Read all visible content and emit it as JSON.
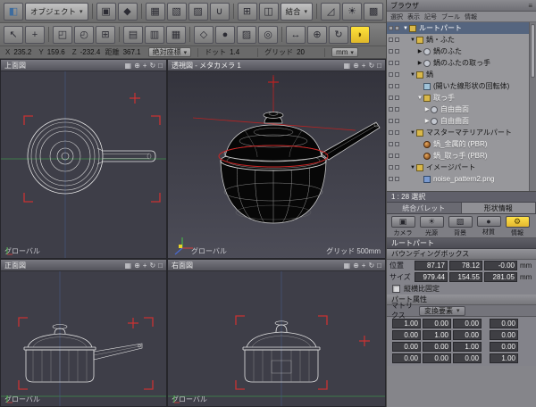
{
  "ui": {
    "dropdown_arrow": "▾"
  },
  "toolbar": {
    "row1": [
      {
        "type": "icon",
        "name": "object-cube-icon",
        "glyph": "◧",
        "tint": "#3d6c9e"
      },
      {
        "type": "drop",
        "name": "object-mode-dropdown",
        "label": "オブジェクト"
      },
      {
        "type": "sep"
      },
      {
        "type": "icon",
        "name": "create-part-icon",
        "glyph": "▣"
      },
      {
        "type": "icon",
        "name": "create-primitive-icon",
        "glyph": "◆"
      },
      {
        "type": "sep"
      },
      {
        "type": "icon",
        "name": "polygon-mesh-icon",
        "glyph": "▦"
      },
      {
        "type": "icon",
        "name": "subdivision-surface-icon",
        "glyph": "▧"
      },
      {
        "type": "icon",
        "name": "line-shape-icon",
        "glyph": "▨"
      },
      {
        "type": "icon",
        "name": "snap-magnet-icon",
        "glyph": "∪"
      },
      {
        "type": "sep"
      },
      {
        "type": "icon",
        "name": "grid-snap-icon",
        "glyph": "⊞"
      },
      {
        "type": "icon",
        "name": "mirror-icon",
        "glyph": "◫"
      },
      {
        "type": "drop",
        "name": "join-mode-dropdown",
        "label": "結合"
      },
      {
        "type": "sep"
      },
      {
        "type": "icon",
        "name": "measure-icon",
        "glyph": "◿"
      },
      {
        "type": "icon",
        "name": "light-icon",
        "glyph": "☀"
      },
      {
        "type": "icon",
        "name": "render-settings-icon",
        "glyph": "▩"
      }
    ],
    "row2": [
      {
        "type": "icon",
        "name": "select-tool-icon",
        "glyph": "↖"
      },
      {
        "type": "icon",
        "name": "move-tool-icon",
        "glyph": "+"
      },
      {
        "type": "sep"
      },
      {
        "type": "icon",
        "name": "scale-manipulator-icon",
        "glyph": "◰"
      },
      {
        "type": "icon",
        "name": "rotate-manipulator-icon",
        "glyph": "◴"
      },
      {
        "type": "icon",
        "name": "grid-plane-icon",
        "glyph": "⊞"
      },
      {
        "type": "sep"
      },
      {
        "type": "icon",
        "name": "layout-single-view-icon",
        "glyph": "▤"
      },
      {
        "type": "icon",
        "name": "layout-quad-view-icon",
        "glyph": "▥"
      },
      {
        "type": "icon",
        "name": "layout-custom-view-icon",
        "glyph": "▦"
      },
      {
        "type": "sep"
      },
      {
        "type": "icon",
        "name": "wireframe-display-icon",
        "glyph": "◇"
      },
      {
        "type": "icon",
        "name": "shaded-display-icon",
        "glyph": "●"
      },
      {
        "type": "icon",
        "name": "texture-display-icon",
        "glyph": "▨"
      },
      {
        "type": "icon",
        "name": "camera-display-icon",
        "glyph": "◎"
      },
      {
        "type": "sep"
      },
      {
        "type": "icon",
        "name": "pan-view-icon",
        "glyph": "↔"
      },
      {
        "type": "icon",
        "name": "zoom-view-icon",
        "glyph": "⊕"
      },
      {
        "type": "icon",
        "name": "rotate-view-icon",
        "glyph": "↻"
      },
      {
        "type": "icon",
        "name": "memo-bubble-icon",
        "glyph": "◗",
        "accent": true
      }
    ]
  },
  "coordbar": {
    "x_label": "X",
    "x": "235.2",
    "y_label": "Y",
    "y": "159.6",
    "z_label": "Z",
    "z": "-232.4",
    "dist_label": "距離",
    "dist": "367.1",
    "mode": "絶対座標",
    "dot_label": "ドット",
    "dot": "1.4",
    "grid_label": "グリッド",
    "grid": "20",
    "unit": "mm"
  },
  "vp_icons": [
    {
      "name": "viewport-layout-icon",
      "glyph": "▦"
    },
    {
      "name": "viewport-zoom-icon",
      "glyph": "⊕"
    },
    {
      "name": "viewport-pan-icon",
      "glyph": "+"
    },
    {
      "name": "viewport-rotate-icon",
      "glyph": "↻"
    },
    {
      "name": "viewport-maximize-icon",
      "glyph": "□"
    }
  ],
  "viewports": {
    "top": {
      "title": "上面図",
      "global_label": "グローバル"
    },
    "perspective": {
      "title": "透視図 - メタカメラ 1",
      "global_label": "グローバル",
      "grid_label": "グリッド 500mm"
    },
    "front": {
      "title": "正面図",
      "global_label": "グローバル"
    },
    "right": {
      "title": "右面図",
      "global_label": "グローバル"
    }
  },
  "browser": {
    "title": "ブラウザ",
    "menu_icon": "≡",
    "columns": [
      "選択",
      "表示",
      "記号",
      "ブール",
      "情報"
    ],
    "tree": [
      {
        "label": "ルートパート",
        "depth": 0,
        "arrow": "▼",
        "icon": "part",
        "selected": true
      },
      {
        "label": "鍋・ふた",
        "depth": 1,
        "arrow": "▼",
        "icon": "part"
      },
      {
        "label": "鍋のふた",
        "depth": 2,
        "arrow": "▶",
        "icon": "surface"
      },
      {
        "label": "鍋のふたの取っ手",
        "depth": 2,
        "arrow": "▶",
        "icon": "surface"
      },
      {
        "label": "鍋",
        "depth": 1,
        "arrow": "▼",
        "icon": "part"
      },
      {
        "label": "(開いた線形状の回転体)",
        "depth": 2,
        "arrow": "",
        "icon": "shape"
      },
      {
        "label": "取っ手",
        "depth": 2,
        "arrow": "▼",
        "icon": "part",
        "light": true
      },
      {
        "label": "自由曲面",
        "depth": 3,
        "arrow": "▶",
        "icon": "surface",
        "light": true
      },
      {
        "label": "自由曲面",
        "depth": 3,
        "arrow": "▶",
        "icon": "surface",
        "light": true
      },
      {
        "label": "マスターマテリアルパート",
        "depth": 1,
        "arrow": "▼",
        "icon": "part"
      },
      {
        "label": "鍋_金属的 (PBR)",
        "depth": 2,
        "arrow": "",
        "icon": "material",
        "light": true
      },
      {
        "label": "鍋_取っ手 (PBR)",
        "depth": 2,
        "arrow": "",
        "icon": "material",
        "light": true
      },
      {
        "label": "イメージパート",
        "depth": 1,
        "arrow": "▼",
        "icon": "part"
      },
      {
        "label": "noise_pattern2.png",
        "depth": 2,
        "arrow": "",
        "icon": "image",
        "light": true
      }
    ]
  },
  "statusbar": {
    "selection": "1 : 28 選択"
  },
  "palette": {
    "tabs": [
      {
        "label": "統合パレット",
        "active": false
      },
      {
        "label": "形状情報",
        "active": true
      }
    ],
    "icons": [
      {
        "name": "camera-tab-icon",
        "glyph": "▣",
        "label": "カメラ"
      },
      {
        "name": "light-tab-icon",
        "glyph": "☀",
        "label": "光源"
      },
      {
        "name": "background-tab-icon",
        "glyph": "▨",
        "label": "背景"
      },
      {
        "name": "material-tab-icon",
        "glyph": "●",
        "label": "材質"
      },
      {
        "name": "info-tab-icon",
        "glyph": "⚙",
        "label": "情報",
        "active": true
      }
    ]
  },
  "shape_info": {
    "part_name": "ルートパート",
    "bbox_title": "バウンディングボックス",
    "position": {
      "label": "位置",
      "values": [
        "87.17",
        "78.12",
        "-0.00"
      ],
      "unit": "mm"
    },
    "size": {
      "label": "サイズ",
      "values": [
        "979.44",
        "154.55",
        "281.05"
      ],
      "unit": "mm"
    },
    "aspect_lock_label": "縦横比固定",
    "part_attr_title": "パート属性",
    "matrix_label": "マトリクス",
    "transform_dropdown": "変換要素",
    "matrix": [
      [
        "1.00",
        "0.00",
        "0.00",
        "0.00"
      ],
      [
        "0.00",
        "1.00",
        "0.00",
        "0.00"
      ],
      [
        "0.00",
        "0.00",
        "1.00",
        "0.00"
      ],
      [
        "0.00",
        "0.00",
        "0.00",
        "1.00"
      ]
    ]
  }
}
